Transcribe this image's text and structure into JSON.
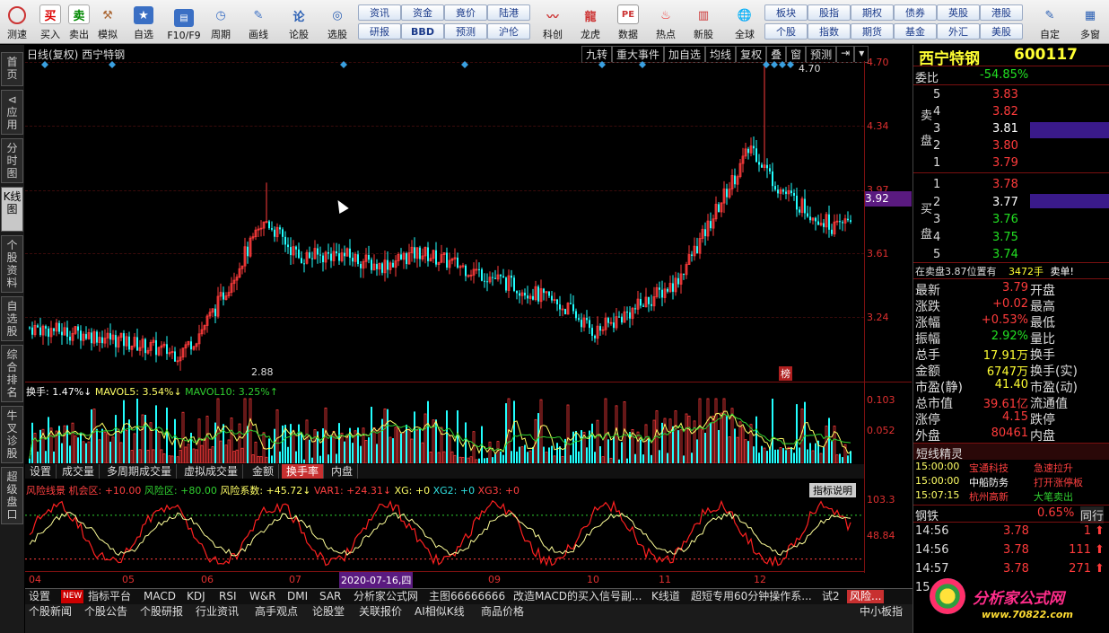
{
  "toolbar": {
    "buttons": [
      {
        "label": "测速",
        "icon": "clock-icon"
      },
      {
        "label": "买入",
        "icon": "buy-icon",
        "glyph": "买"
      },
      {
        "label": "卖出",
        "icon": "sell-icon",
        "glyph": "卖"
      },
      {
        "label": "模拟",
        "icon": "hammer-icon"
      },
      {
        "label": "自选",
        "icon": "star-icon"
      },
      {
        "label": "F10/F9",
        "icon": "f10-icon"
      },
      {
        "label": "周期",
        "icon": "period-icon"
      },
      {
        "label": "画线",
        "icon": "pencil-icon"
      },
      {
        "label": "论股",
        "icon": "forum-icon"
      },
      {
        "label": "选股",
        "icon": "select-icon"
      },
      {
        "label": "科创",
        "icon": "kechuang-icon"
      },
      {
        "label": "龙虎",
        "icon": "dragon-icon"
      },
      {
        "label": "数据",
        "icon": "pe-icon",
        "glyph": "PE"
      },
      {
        "label": "热点",
        "icon": "fire-icon"
      },
      {
        "label": "新股",
        "icon": "newstock-icon"
      },
      {
        "label": "全球",
        "icon": "globe-icon"
      },
      {
        "label": "自定",
        "icon": "custom-icon"
      },
      {
        "label": "多窗",
        "icon": "multiwindow-icon"
      }
    ],
    "small_buttons_row1": [
      "资讯",
      "资金",
      "竟价",
      "陆港"
    ],
    "small_buttons_row2": [
      "研报",
      "BBD",
      "预测",
      "沪伦"
    ],
    "small_buttons_row3": [
      "板块",
      "股指",
      "期权",
      "债券",
      "英股",
      "港股"
    ],
    "small_buttons_row4": [
      "个股",
      "指数",
      "期货",
      "基金",
      "外汇",
      "美股"
    ]
  },
  "left_tabs": [
    "首页",
    "应用",
    "分时图",
    "K线图",
    "个股资料",
    "自选股",
    "综合排名",
    "牛叉诊股",
    "超级盘口"
  ],
  "chart": {
    "header": "日线(复权) 西宁特钢",
    "menu": [
      "九转",
      "重大事件",
      "加自选",
      "均线",
      "复权",
      "叠",
      "窗",
      "预测"
    ],
    "price_axis": [
      "4.70",
      "4.34",
      "3.97",
      "3.61",
      "3.24"
    ],
    "current_price_tag": "3.92",
    "high_label": "4.70",
    "low_label": "2.88",
    "bang_label": "榜",
    "volume_header": {
      "a": "换手: 1.47%↓",
      "b": "MAVOL5: 3.54%↓",
      "c": "MAVOL10: 3.25%↑"
    },
    "volume_axis": [
      "0.103",
      "0.052"
    ],
    "vol_tabs": [
      "设置",
      "成交量",
      "多周期成交量",
      "虚拟成交量",
      "金额",
      "换手率",
      "内盘"
    ],
    "risk_header": {
      "a": "风险线景",
      "b": "机会区: +10.00",
      "c": "风险区: +80.00",
      "d": "风险系数: +45.72↓",
      "e": "VAR1: +24.31↓",
      "f": "XG: +0",
      "g": "XG2: +0",
      "h": "XG3: +0"
    },
    "risk_btn": "指标说明",
    "risk_axis": [
      "103.3",
      "48.84"
    ],
    "months": [
      "04",
      "05",
      "06",
      "07",
      "2020-07-16,四",
      "09",
      "10",
      "11",
      "12"
    ]
  },
  "bottom_tabs": [
    "设置",
    "NEW",
    "指标平台",
    "MACD",
    "KDJ",
    "RSI",
    "W&R",
    "DMI",
    "SAR",
    "分析家公式网",
    "主图66666666",
    "改造MACD的买入信号副...",
    "K线道",
    "超短专用60分钟操作系...",
    "试2",
    "风险..."
  ],
  "bottom_tabs2": [
    "个股新闻",
    "个股公告",
    "个股研报",
    "行业资讯",
    "高手观点",
    "论股堂",
    "关联报价",
    "AI相似K线",
    "商品价格",
    "中小板指"
  ],
  "stock": {
    "name": "西宁特钢",
    "code": "600117"
  },
  "orderbook": {
    "weibi_label": "委比",
    "weibi": "-54.85%",
    "sell_label": "卖盘",
    "buy_label": "买盘",
    "sells": [
      {
        "n": "5",
        "p": "3.83"
      },
      {
        "n": "4",
        "p": "3.82"
      },
      {
        "n": "3",
        "p": "3.81"
      },
      {
        "n": "2",
        "p": "3.80"
      },
      {
        "n": "1",
        "p": "3.79"
      }
    ],
    "buys": [
      {
        "n": "1",
        "p": "3.78"
      },
      {
        "n": "2",
        "p": "3.77"
      },
      {
        "n": "3",
        "p": "3.76"
      },
      {
        "n": "4",
        "p": "3.75"
      },
      {
        "n": "5",
        "p": "3.74"
      }
    ],
    "note_a": "在卖盘3.87位置有",
    "note_b": "3472手",
    "note_c": "卖单!"
  },
  "quote": {
    "rows": [
      {
        "k": "最新",
        "v": "3.79",
        "k2": "开盘"
      },
      {
        "k": "涨跌",
        "v": "+0.02",
        "k2": "最高"
      },
      {
        "k": "涨幅",
        "v": "+0.53%",
        "k2": "最低"
      },
      {
        "k": "振幅",
        "v": "2.92%",
        "k2": "量比"
      },
      {
        "k": "总手",
        "v": "17.91万",
        "k2": "换手"
      },
      {
        "k": "金额",
        "v": "6747万",
        "k2": "换手(实)"
      },
      {
        "k": "市盈(静)",
        "v": "41.40",
        "k2": "市盈(动)"
      },
      {
        "k": "总市值",
        "v": "39.61亿",
        "k2": "流通值"
      },
      {
        "k": "涨停",
        "v": "4.15",
        "k2": "跌停"
      },
      {
        "k": "外盘",
        "v": "80461",
        "k2": "内盘"
      }
    ]
  },
  "elf": {
    "title": "短线精灵",
    "items": [
      {
        "t": "15:00:00",
        "s": "宝通科技",
        "e": "急速拉升"
      },
      {
        "t": "15:00:00",
        "s": "中船防务",
        "e": "打开涨停板"
      },
      {
        "t": "15:07:15",
        "s": "杭州高新",
        "e": "大笔卖出"
      }
    ]
  },
  "sector": {
    "name": "钢铁",
    "pct": "0.65%",
    "btn": "同行"
  },
  "ticks": [
    {
      "t": "14:56",
      "p": "3.78",
      "v": "1"
    },
    {
      "t": "14:56",
      "p": "3.78",
      "v": "111"
    },
    {
      "t": "14:57",
      "p": "3.78",
      "v": "271"
    },
    {
      "t": "15",
      "p": "",
      "v": ""
    }
  ],
  "watermark": {
    "a": "分析家公式网",
    "b": "www.70822.com"
  },
  "colors": {
    "up": "#ff3b3b",
    "down": "#22ffff",
    "bg": "#000000",
    "risk_red": "#ff2020",
    "risk_yellow": "#ffff99"
  }
}
